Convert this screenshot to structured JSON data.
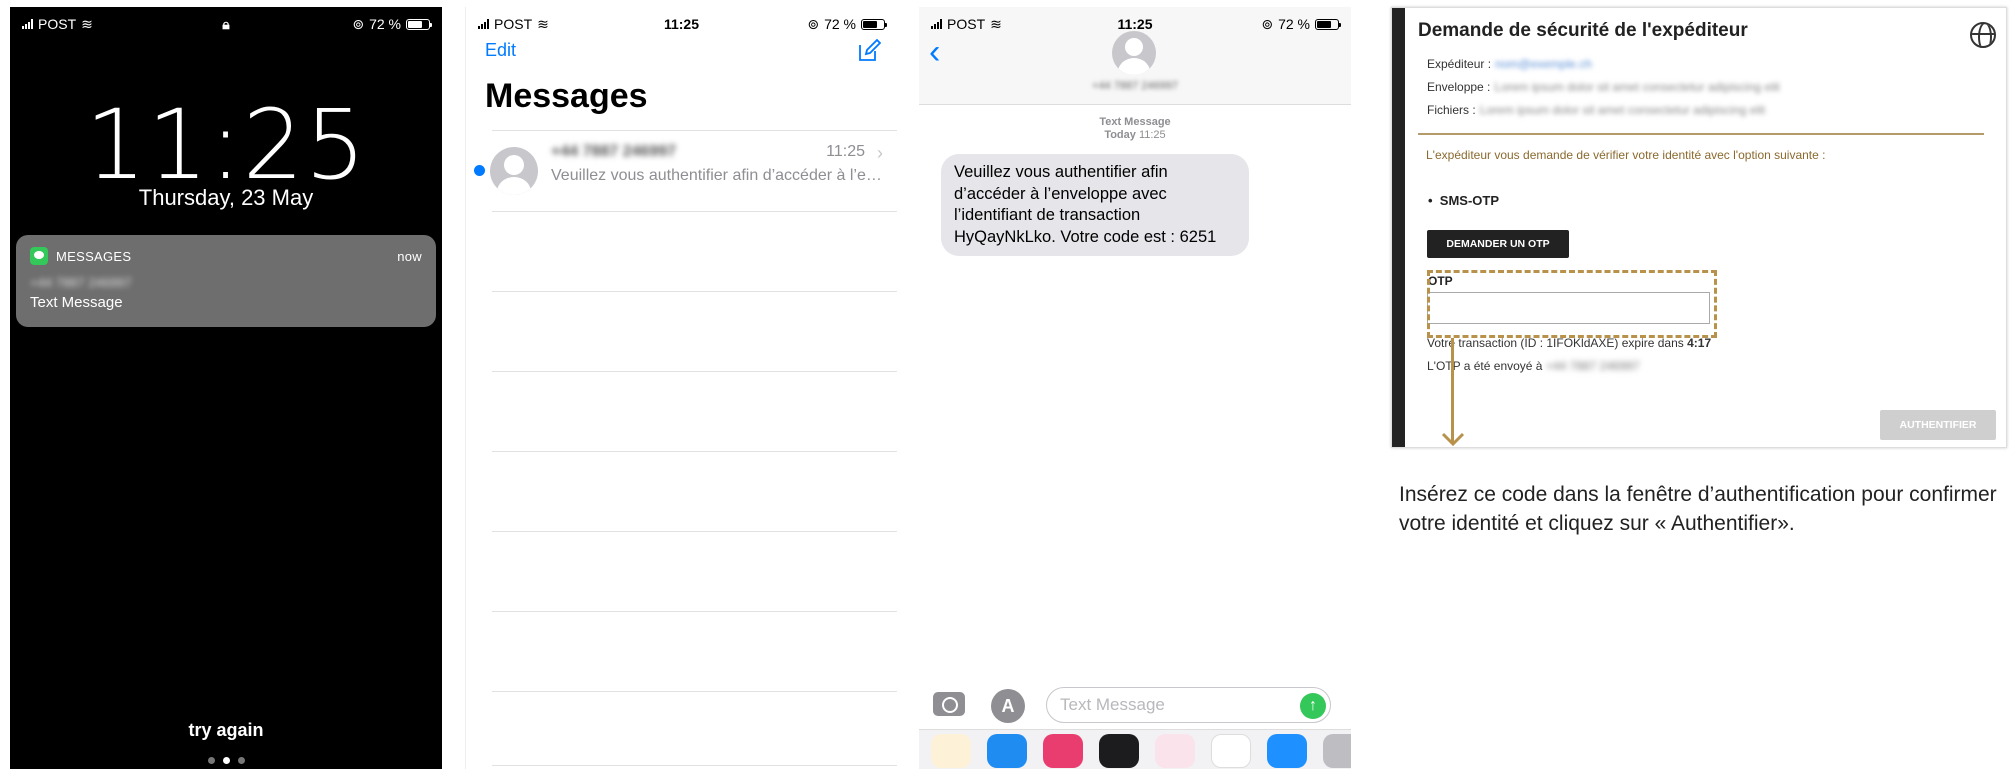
{
  "lock": {
    "carrier": "POST",
    "battery": "72 %",
    "time": "11:25",
    "date": "Thursday, 23 May",
    "notification": {
      "app": "MESSAGES",
      "when": "now",
      "sender": "+44 7887 246997",
      "title": "Text Message"
    },
    "try_again": "try again"
  },
  "list": {
    "carrier": "POST",
    "time": "11:25",
    "battery": "72 %",
    "edit": "Edit",
    "title": "Messages",
    "conversation": {
      "sender": "+44 7887 246997",
      "time": "11:25",
      "preview": "Veuillez vous authentifier afin d’accéder à l’e…"
    }
  },
  "conversation": {
    "carrier": "POST",
    "time": "11:25",
    "battery": "72 %",
    "contact": "+44 7887 246997",
    "meta_type": "Text Message",
    "meta_day": "Today",
    "meta_time": "11:25",
    "message": "Veuillez vous authentifier afin d’accéder à l’enveloppe avec l’identifiant de transaction HyQayNkLko. Votre code est : 6251",
    "input_placeholder": "Text Message"
  },
  "form": {
    "title": "Demande de sécurité de l'expéditeur",
    "sender_label": "Expéditeur :",
    "sender_value": "nom@exemple.ch",
    "envelope_label": "Enveloppe :",
    "envelope_value": "Lorem ipsum dolor sit amet consectetur adipiscing elit",
    "files_label": "Fichiers :",
    "files_value": "Lorem ipsum dolor sit amet consectetur adipiscing elit",
    "info": "L'expéditeur vous demande de vérifier votre identité avec l'option suivante :",
    "option": "SMS-OTP",
    "request_button": "DEMANDER UN OTP",
    "otp_label": "OTP",
    "transaction_prefix": "Votre transaction (ID : 1IFOKldAXE) expire dans",
    "countdown": "4:17",
    "sent_to": "L'OTP a été envoyé à",
    "sent_to_value": "+44 7887 246997",
    "auth_button": "AUTHENTIFIER",
    "colors": {
      "accent": "#b8924a",
      "dark": "#222222"
    }
  },
  "caption": "Insérez ce code dans la fenêtre d’authentification pour confirmer votre identité et cliquez sur « Authentifier»."
}
